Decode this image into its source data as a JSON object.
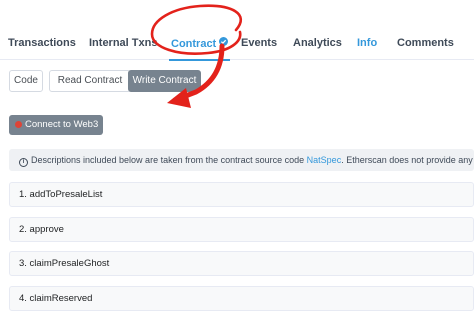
{
  "tabs": [
    {
      "label": "Transactions",
      "active": false
    },
    {
      "label": "Internal Txns",
      "active": false
    },
    {
      "label": "Contract",
      "active": true,
      "verified": true
    },
    {
      "label": "Events",
      "active": false
    },
    {
      "label": "Analytics",
      "active": false
    },
    {
      "label": "Info",
      "active": false,
      "highlight": true
    },
    {
      "label": "Comments",
      "active": false
    }
  ],
  "buttons": {
    "code": "Code",
    "read_contract": "Read Contract",
    "write_contract": "Write Contract"
  },
  "connect": {
    "label": "Connect to Web3",
    "status_color": "#de4437"
  },
  "info_bar": {
    "icon": "ⓘ",
    "text_before": "Descriptions included below are taken from the contract source code",
    "link": "NatSpec",
    "text_after": ". Etherscan does not provide any"
  },
  "functions": [
    {
      "label": "1. addToPresaleList"
    },
    {
      "label": "2. approve"
    },
    {
      "label": "3. claimPresaleGhost"
    },
    {
      "label": "4. claimReserved"
    }
  ],
  "colors": {
    "accent": "#3498db",
    "annotation": "#e3221b",
    "button_dark": "#77838f"
  }
}
